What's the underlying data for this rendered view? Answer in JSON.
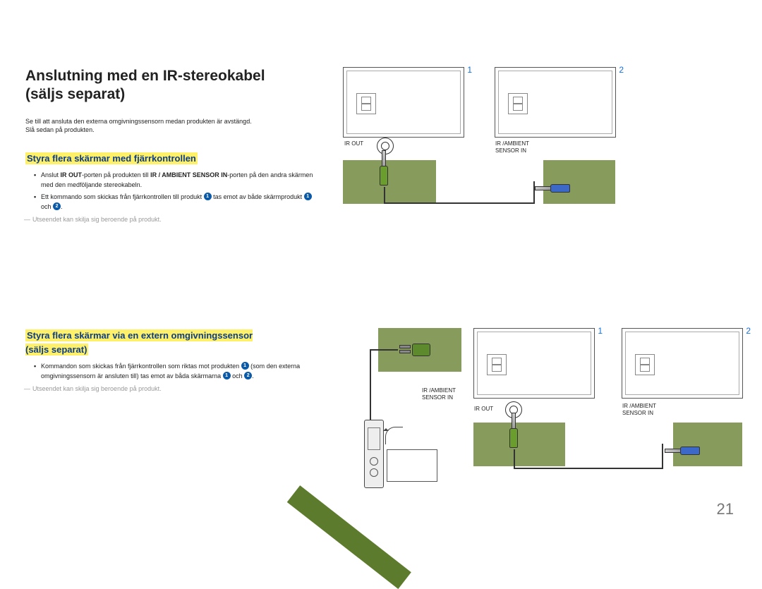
{
  "title_line1": "Anslutning med en IR-stereokabel",
  "title_line2": "(säljs separat)",
  "intro_line1": "Se till att ansluta den externa omgivningssensorn medan produkten är avstängd.",
  "intro_line2": "Slå sedan på produkten.",
  "section1": {
    "heading": "Styra flera skärmar med fjärrkontrollen",
    "b1_pre": "Anslut ",
    "b1_bold1": "IR OUT",
    "b1_mid": "-porten på produkten till ",
    "b1_bold2": "IR / AMBIENT SENSOR IN",
    "b1_post": "-porten på den andra skärmen med den medföljande stereokabeln.",
    "b2_pre": "Ett kommando som skickas från fjärrkontrollen till produkt ",
    "b2_num1": "1",
    "b2_mid": " tas emot av både skärmprodukt ",
    "b2_num2": "1",
    "b2_och": " och ",
    "b2_num3": "2",
    "b2_end": ".",
    "note": "Utseendet kan skilja sig beroende på produkt."
  },
  "section2": {
    "heading_line1": "Styra flera skärmar via en extern omgivningssensor",
    "heading_line2": "(säljs separat)",
    "b1_pre": "Kommandon som skickas från fjärrkontrollen som riktas mot produkten ",
    "b1_num1": "1",
    "b1_mid": " (som den externa omgivningssensorn är ansluten till) tas emot av båda skärmarna ",
    "b1_num2": "1",
    "b1_och": " och ",
    "b1_num3": "2",
    "b1_end": ".",
    "note": "Utseendet kan skilja sig beroende på produkt."
  },
  "diagram": {
    "num1": "1",
    "num2": "2",
    "ir_out": "IR OUT",
    "ir_ambient_in": "IR /AMBIENT\nSENSOR IN"
  },
  "page_number": "21"
}
